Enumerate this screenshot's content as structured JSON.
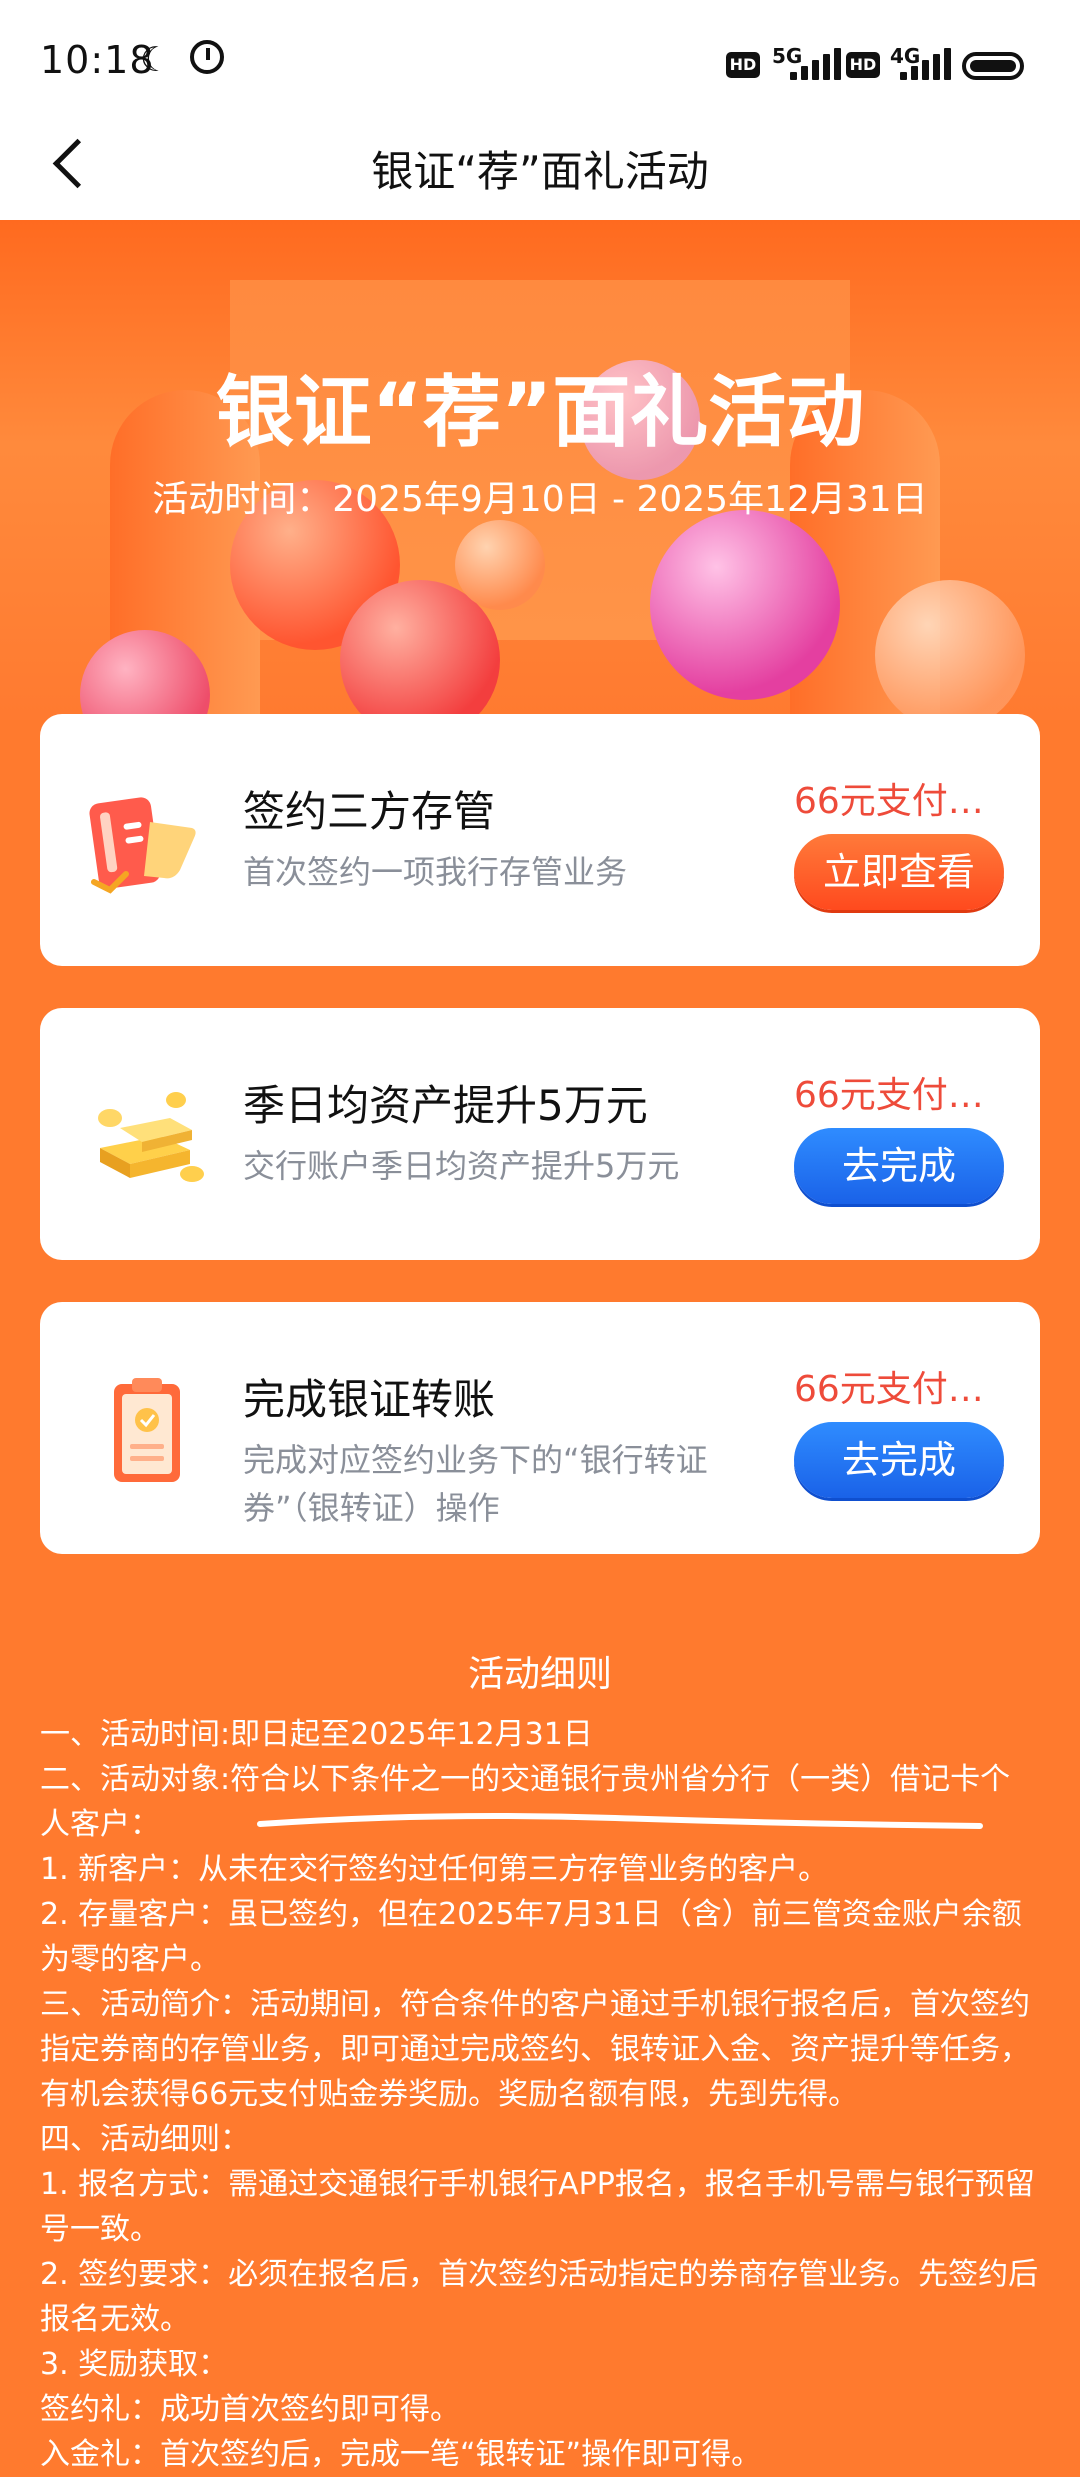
{
  "status_bar": {
    "time": "10:18",
    "network_1": "5G",
    "network_2": "4G",
    "hd_label": "HD"
  },
  "nav": {
    "title": "银证“荐”面礼活动"
  },
  "banner": {
    "title": "银证“荐”面礼活动",
    "subtitle": "活动时间：2025年9月10日 - 2025年12月31日"
  },
  "tasks": [
    {
      "title": "签约三方存管",
      "desc": "首次签约一项我行存管业务",
      "reward": "66元支付…",
      "button": "立即查看"
    },
    {
      "title": "季日均资产提升5万元",
      "desc": "交行账户季日均资产提升5万元",
      "reward": "66元支付…",
      "button": "去完成"
    },
    {
      "title": "完成银证转账",
      "desc": "完成对应签约业务下的“银行转证券”（银转证）操作",
      "reward": "66元支付…",
      "button": "去完成"
    }
  ],
  "rules": {
    "title": "活动细则",
    "lines": [
      "一、活动时间:即日起至2025年12月31日",
      "二、活动对象:符合以下条件之一的交通银行贵州省分行（一类）借记卡个人客户：",
      "1. 新客户：从未在交行签约过任何第三方存管业务的客户。",
      "2. 存量客户：虽已签约，但在2025年7月31日（含）前三管资金账户余额为零的客户。",
      "三、活动简介：活动期间，符合条件的客户通过手机银行报名后，首次签约指定券商的存管业务，即可通过完成签约、银转证入金、资产提升等任务，有机会获得66元支付贴金券奖励。奖励名额有限，先到先得。",
      "四、活动细则：",
      "1. 报名方式：需通过交通银行手机银行APP报名，报名手机号需与银行预留号一致。",
      "2. 签约要求：必须在报名后，首次签约活动指定的券商存管业务。先签约后报名无效。",
      "3. 奖励获取：",
      "签约礼：成功首次签约即可得。",
      "入金礼：首次签约后，完成一笔“银转证”操作即可得。"
    ]
  },
  "colors": {
    "page_bg": "#ff7a2e",
    "orange_button": "#ff5a24",
    "blue_button": "#1f6ff0",
    "reward_text": "#ee4b3a"
  }
}
